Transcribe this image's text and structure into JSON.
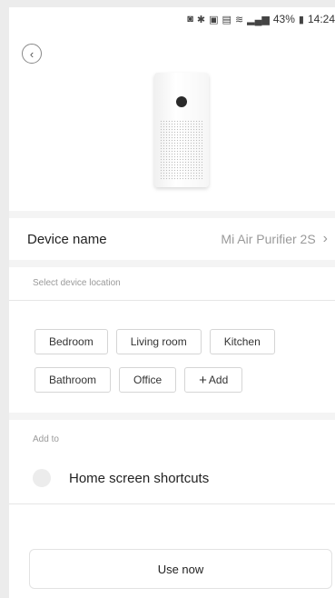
{
  "status_bar": {
    "icons": [
      "notification-icon",
      "bluetooth-icon",
      "vibrate-icon",
      "volte-icon",
      "wifi-icon",
      "signal-icon"
    ],
    "battery": "43%",
    "time": "14:24"
  },
  "header": {
    "back_icon": "chevron-left-icon"
  },
  "device": {
    "name_label": "Device name",
    "name_value": "Mi Air Purifier 2S"
  },
  "location": {
    "caption": "Select device location",
    "options": [
      "Bedroom",
      "Living room",
      "Kitchen",
      "Bathroom",
      "Office"
    ],
    "add_label": "Add"
  },
  "add_to": {
    "caption": "Add to",
    "shortcut_label": "Home screen shortcuts"
  },
  "footer": {
    "use_now_label": "Use now"
  }
}
